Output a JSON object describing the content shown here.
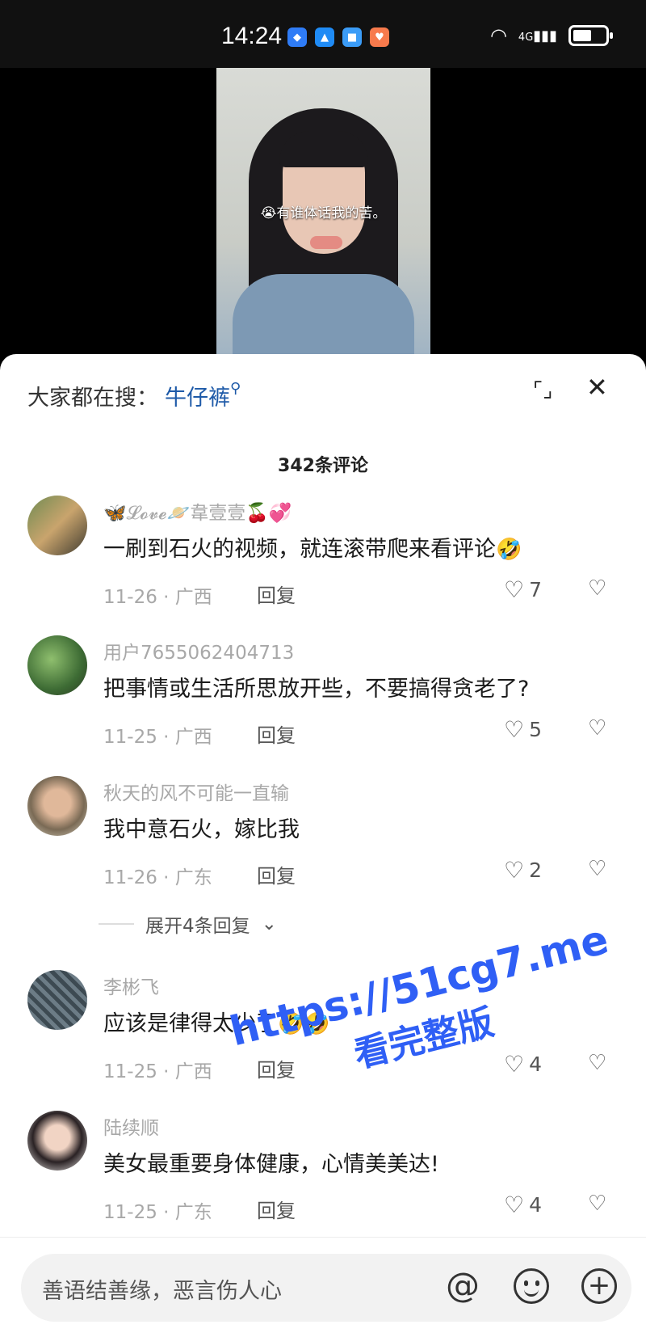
{
  "status_bar": {
    "time": "14:24",
    "network": "4G"
  },
  "video": {
    "caption": "😭有谁体话我的苦。"
  },
  "search_hint": {
    "prefix": "大家都在搜：",
    "keyword": "牛仔裤"
  },
  "comment_count": "342条评论",
  "comments": [
    {
      "user": "🦋𝓛𝓸𝓿𝓮🪐韋壹壹🍒💞",
      "text": "一刷到石火的视频，就连滚带爬来看评论",
      "emoji": "🤣",
      "date_loc": "11-26 · 广西",
      "reply": "回复",
      "likes": "7"
    },
    {
      "user": "用户7655062404713",
      "text": "把事情或生活所思放开些，不要搞得贪老了?",
      "emoji": "",
      "date_loc": "11-25 · 广西",
      "reply": "回复",
      "likes": "5"
    },
    {
      "user": "秋天的风不可能一直输",
      "text": "我中意石火，嫁比我",
      "emoji": "",
      "date_loc": "11-26 · 广东",
      "reply": "回复",
      "likes": "2"
    },
    {
      "user": "李彬飞",
      "text": "应该是律得太少了",
      "emoji": "🤣🤣",
      "date_loc": "11-25 · 广西",
      "reply": "回复",
      "likes": "4"
    },
    {
      "user": "陆续顺",
      "text": "美女最重要身体健康，心情美美达!",
      "emoji": "",
      "date_loc": "11-25 · 广东",
      "reply": "回复",
      "likes": "4"
    }
  ],
  "expand_replies": "展开4条回复",
  "watermark": {
    "line1": "https://51cg7.me",
    "line2": "看完整版"
  },
  "input": {
    "placeholder": "善语结善缘，恶言伤人心"
  }
}
